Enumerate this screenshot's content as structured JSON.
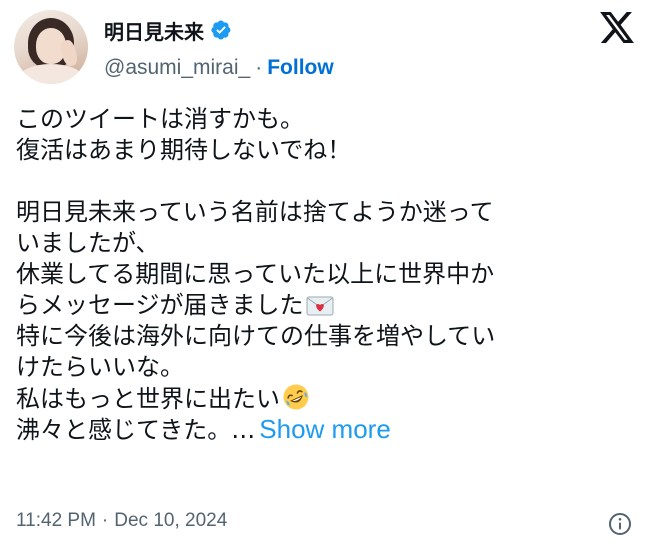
{
  "author": {
    "display_name": "明日見未来",
    "handle": "@asumi_mirai_",
    "separator": "·",
    "follow_label": "Follow",
    "verified_icon": "verified-badge-icon",
    "verified_color": "#1d9bf0"
  },
  "brand": {
    "logo": "x-logo-icon"
  },
  "tweet": {
    "lines": [
      "このツイートは消すかも。",
      "復活はあまり期待しないでね！",
      "",
      "明日見未来っていう名前は捨てようか迷って",
      "いましたが、",
      "休業してる期間に思っていた以上に世界中か",
      "らメッセージが届きました",
      "特に今後は海外に向けての仕事を増やしてい",
      "けたらいいな。",
      "私はもっと世界に出たい",
      "沸々と感じてきた。…"
    ],
    "emoji_love_letter": "love-letter-emoji",
    "emoji_rofl": "rolling-on-floor-laughing-emoji",
    "show_more_label": "Show more"
  },
  "footer": {
    "time": "11:42 PM",
    "separator": "·",
    "date": "Dec 10, 2024",
    "info_icon": "info-icon"
  },
  "colors": {
    "text": "#0f1419",
    "secondary": "#536471",
    "link": "#1d9bf0",
    "follow": "#006fd6"
  }
}
